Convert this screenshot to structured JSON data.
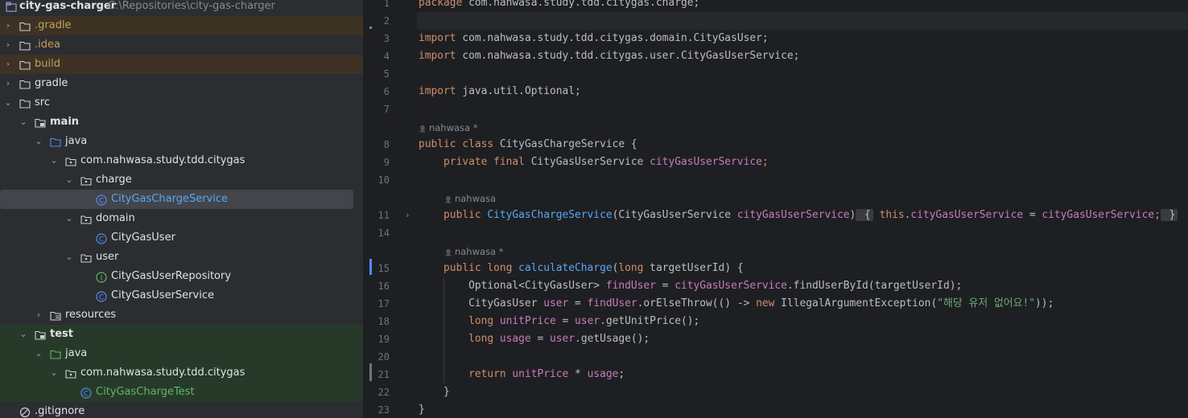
{
  "project": {
    "root_name": "city-gas-charger",
    "root_path": "C:\\Repositories\\city-gas-charger",
    "items": [
      {
        "label": ".gradle",
        "arrow": "›",
        "kind": "folder"
      },
      {
        "label": ".idea",
        "arrow": "›",
        "kind": "folder"
      },
      {
        "label": "build",
        "arrow": "›",
        "kind": "folder"
      },
      {
        "label": "gradle",
        "arrow": "›",
        "kind": "folder"
      },
      {
        "label": "src",
        "arrow": "⌄",
        "kind": "folder"
      },
      {
        "label": "main",
        "arrow": "⌄",
        "kind": "source-folder"
      },
      {
        "label": "java",
        "arrow": "⌄",
        "kind": "source-root"
      },
      {
        "label": "com.nahwasa.study.tdd.citygas",
        "arrow": "⌄",
        "kind": "package"
      },
      {
        "label": "charge",
        "arrow": "⌄",
        "kind": "package"
      },
      {
        "label": "CityGasChargeService",
        "arrow": "",
        "kind": "class"
      },
      {
        "label": "domain",
        "arrow": "⌄",
        "kind": "package"
      },
      {
        "label": "CityGasUser",
        "arrow": "",
        "kind": "class"
      },
      {
        "label": "user",
        "arrow": "⌄",
        "kind": "package"
      },
      {
        "label": "CityGasUserRepository",
        "arrow": "",
        "kind": "interface"
      },
      {
        "label": "CityGasUserService",
        "arrow": "",
        "kind": "class"
      },
      {
        "label": "resources",
        "arrow": "›",
        "kind": "resources"
      },
      {
        "label": "test",
        "arrow": "⌄",
        "kind": "source-folder"
      },
      {
        "label": "java",
        "arrow": "⌄",
        "kind": "test-root"
      },
      {
        "label": "com.nahwasa.study.tdd.citygas",
        "arrow": "⌄",
        "kind": "package"
      },
      {
        "label": "CityGasChargeTest",
        "arrow": "",
        "kind": "test-class"
      },
      {
        "label": ".gitignore",
        "arrow": "",
        "kind": "ignore-file"
      }
    ]
  },
  "editor": {
    "line_numbers": [
      "1",
      "2",
      "3",
      "4",
      "5",
      "6",
      "7",
      "8",
      "9",
      "10",
      "11",
      "14",
      "15",
      "16",
      "17",
      "18",
      "19",
      "20",
      "21",
      "22",
      "23"
    ],
    "author_hints": [
      "nahwasa *",
      "nahwasa",
      "nahwasa *"
    ],
    "code": {
      "l1_kw": "package",
      "l1_rest": " com.nahwasa.study.tdd.citygas.charge;",
      "l3_kw": "import",
      "l3_rest": " com.nahwasa.study.tdd.citygas.domain.CityGasUser;",
      "l4_kw": "import",
      "l4_rest": " com.nahwasa.study.tdd.citygas.user.CityGasUserService;",
      "l6_kw": "import",
      "l6_rest": " java.util.Optional;",
      "l8_kw": "public class",
      "l8_rest": " CityGasChargeService {",
      "l9_kw": "    private final",
      "l9_type": " CityGasUserService ",
      "l9_fld": "cityGasUserService",
      "l9_end": ";",
      "l11_kw": "    public",
      "l11_fn": " CityGasChargeService",
      "l11_params": "(CityGasUserService ",
      "l11_param": "cityGasUserService",
      "l11_close": ")",
      "l11_open": " {",
      "l11_this": " this",
      "l11_dot": ".",
      "l11_fld": "cityGasUserService",
      "l11_eq": " = ",
      "l11_val": "cityGasUserService",
      "l11_semi": ";",
      "l11_close2": " }",
      "l15_kw": "    public long",
      "l15_fn": " calculateCharge",
      "l15_params": "(",
      "l15_kw2": "long",
      "l15_param": " targetUserId) {",
      "l16_a": "        Optional<CityGasUser> ",
      "l16_var": "findUser",
      "l16_b": " = ",
      "l16_fld": "cityGasUserService",
      "l16_c": ".findUserById(targetUserId);",
      "l17_a": "        CityGasUser ",
      "l17_var": "user",
      "l17_b": " = ",
      "l17_var2": "findUser",
      "l17_c": ".orElseThrow(() -> ",
      "l17_kw": "new",
      "l17_d": " IllegalArgumentException(",
      "l17_str": "\"해당 유저 없어요!\"",
      "l17_e": "));",
      "l18_kw": "        long",
      "l18_var": " unitPrice",
      "l18_b": " = ",
      "l18_var2": "user",
      "l18_c": ".getUnitPrice();",
      "l19_kw": "        long",
      "l19_var": " usage",
      "l19_b": " = ",
      "l19_var2": "user",
      "l19_c": ".getUsage();",
      "l21_kw": "        return",
      "l21_var": " unitPrice",
      "l21_b": " * ",
      "l21_var2": "usage",
      "l21_c": ";",
      "l22": "    }",
      "l23": "}"
    }
  },
  "colors": {
    "accent": "#56a8f5",
    "keyword": "#cf8e6d",
    "field": "#c77dbb",
    "string": "#6aab73"
  }
}
